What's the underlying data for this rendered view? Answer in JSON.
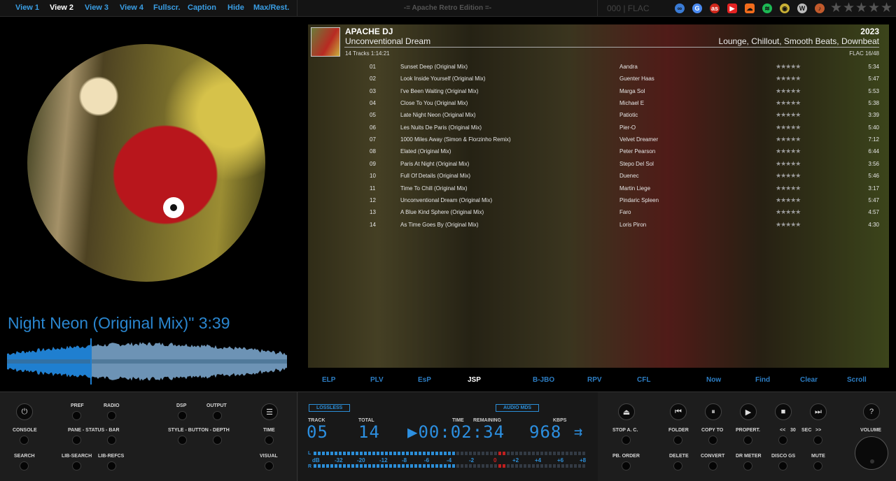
{
  "topbar": {
    "nav": [
      "View 1",
      "View 2",
      "View 3",
      "View 4",
      "Fullscr.",
      "Caption",
      "Hide",
      "Max/Rest."
    ],
    "active_nav": "View 2",
    "edition": "-= Apache Retro Edition =-",
    "format": "000 | FLAC",
    "icons": [
      "link-icon",
      "google-icon",
      "lastfm-icon",
      "youtube-icon",
      "soundcloud-icon",
      "spotify-icon",
      "discogs-icon",
      "wikipedia-icon",
      "musicbrainz-icon"
    ]
  },
  "now_playing": {
    "title": "Night Neon (Original Mix)\" 3:39"
  },
  "playlist": {
    "artist": "APACHE DJ",
    "album": "Unconventional Dream",
    "year": "2023",
    "genre": "Lounge, Chillout, Smooth Beats, Downbeat",
    "tracks_info": "14 Tracks   1:14:21",
    "format_info": "FLAC   16/48",
    "tracks": [
      {
        "num": "01",
        "title": "Sunset Deep (Original Mix)",
        "artist": "Aandra",
        "dur": "5:34"
      },
      {
        "num": "02",
        "title": "Look Inside Yourself (Original Mix)",
        "artist": "Guenter Haas",
        "dur": "5:47"
      },
      {
        "num": "03",
        "title": "I've Been Waiting (Original Mix)",
        "artist": "Marga Sol",
        "dur": "5:53"
      },
      {
        "num": "04",
        "title": "Close To You (Original Mix)",
        "artist": "Michael E",
        "dur": "5:38"
      },
      {
        "num": "05",
        "title": "Late Night Neon (Original Mix)",
        "artist": "Patiotic",
        "dur": "3:39"
      },
      {
        "num": "06",
        "title": "Les Nuits De Paris (Original Mix)",
        "artist": "Pier-O",
        "dur": "5:40"
      },
      {
        "num": "07",
        "title": "1000 Miles Away (Simon & Florzinho Remix)",
        "artist": "Velvet Dreamer",
        "dur": "7:12"
      },
      {
        "num": "08",
        "title": "Elated (Original Mix)",
        "artist": "Peter Pearson",
        "dur": "6:44"
      },
      {
        "num": "09",
        "title": "Paris At Night (Original Mix)",
        "artist": "Stepo Del Sol",
        "dur": "3:56"
      },
      {
        "num": "10",
        "title": "Full Of Details (Original Mix)",
        "artist": "Duenec",
        "dur": "5:46"
      },
      {
        "num": "11",
        "title": "Time To Chill (Original Mix)",
        "artist": "Martin Liege",
        "dur": "3:17"
      },
      {
        "num": "12",
        "title": "Unconventional Dream (Original Mix)",
        "artist": "Pindaric Spleen",
        "dur": "5:47"
      },
      {
        "num": "13",
        "title": "A Blue Kind Sphere (Original Mix)",
        "artist": "Faro",
        "dur": "4:57"
      },
      {
        "num": "14",
        "title": "As Time Goes By (Original Mix)",
        "artist": "Loris Piron",
        "dur": "4:30"
      }
    ]
  },
  "tabs": {
    "left": [
      "ELP",
      "PLV",
      "EsP",
      "JSP",
      "B-JBO",
      "RPV",
      "CFL"
    ],
    "active": "JSP",
    "right": [
      "Now",
      "Find",
      "Clear",
      "Scroll"
    ]
  },
  "controls_left": {
    "row1": [
      "PREF",
      "RADIO",
      "DSP",
      "OUTPUT",
      "TIME"
    ],
    "row2": [
      "CONSOLE",
      "PANE - STATUS - BAR",
      "STYLE - BUTTON - DEPTH"
    ],
    "row3": [
      "SEARCH",
      "LIB-SEARCH",
      "LIB-REFCS",
      "VISUAL"
    ]
  },
  "display": {
    "tag_left": "LOSSLESS",
    "tag_right": "AUDIO MDS",
    "labels": {
      "track": "TRACK",
      "total": "TOTAL",
      "time": "TIME",
      "remaining": "REMAINING",
      "kbps": "KBPS"
    },
    "track": "05",
    "total": "14",
    "time": "▶00:02:34",
    "kbps": "968",
    "meter_l": "L",
    "meter_r": "R",
    "scale": [
      "dB",
      "-32",
      "-20",
      "-12",
      "-8",
      "-6",
      "-4",
      "-2",
      "0",
      "+2",
      "+4",
      "+6",
      "+8"
    ]
  },
  "controls_right": {
    "row2": [
      "STOP A. C.",
      "FOLDER",
      "COPY TO",
      "PROPERT.",
      "<<",
      "30",
      "SEC",
      ">>",
      "VOLUME"
    ],
    "row3": [
      "PB. ORDER",
      "DELETE",
      "CONVERT",
      "DR METER",
      "DISCO GS",
      "MUTE"
    ]
  },
  "colors": {
    "accent": "#2b8ed8",
    "active": "#ffffff",
    "panel": "#1d1d1d"
  }
}
